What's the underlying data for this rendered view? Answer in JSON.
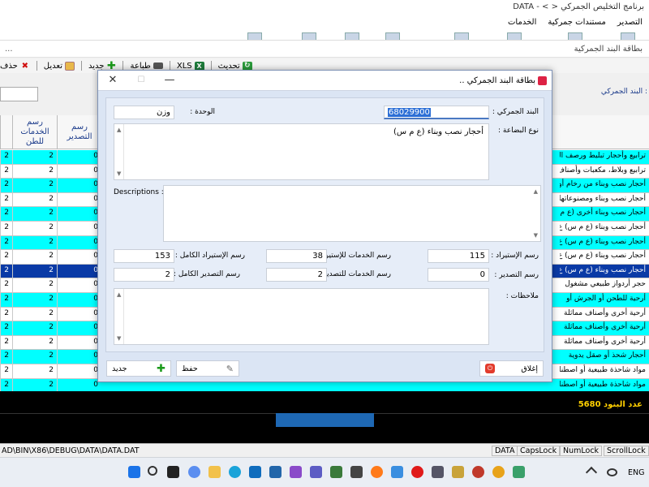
{
  "app": {
    "title": "DATA - < > برنامج التخليص الجمركي",
    "menu": [
      "التصدير",
      "مستندات جمركية",
      "الخدمات"
    ],
    "subtitle": "بطاقة البند الجمركية",
    "subtitle_dots": "..."
  },
  "toolbar": {
    "delete": "حذف",
    "edit": "تعديل",
    "new": "جديد",
    "print": "طباعة",
    "xls": "XLS",
    "refresh": "تحديث"
  },
  "search": {
    "label": "البند الجمركي :",
    "value": ""
  },
  "grid": {
    "headers": {
      "export_fee": "رسم\nالتصدير",
      "services_fee": "رسم\nالخدمات\nللطن",
      "col_a": ""
    },
    "rows": [
      {
        "desc": "ترابيع وأحجار تبليط ورصف الطرق",
        "export": "0",
        "services": "2",
        "a": "2",
        "style": "cyan"
      },
      {
        "desc": "ترابيع وبلاط، مكعبات وأصناف",
        "export": "0",
        "services": "2",
        "a": "2",
        "style": "white"
      },
      {
        "desc": "أحجار نصب وبناء من رخام أو",
        "export": "0",
        "services": "2",
        "a": "2",
        "style": "cyan"
      },
      {
        "desc": "أحجار نصب وبناء ومصنوعاتها",
        "export": "0",
        "services": "2",
        "a": "2",
        "style": "white"
      },
      {
        "desc": "أحجار نصب وبناء أخرى (ع م",
        "export": "0",
        "services": "2",
        "a": "2",
        "style": "cyan"
      },
      {
        "desc": "أحجار نصب وبناء (ع م س) ع",
        "export": "0",
        "services": "2",
        "a": "2",
        "style": "white"
      },
      {
        "desc": "أحجار نصب وبناء (ع م س) ع",
        "export": "0",
        "services": "2",
        "a": "2",
        "style": "cyan"
      },
      {
        "desc": "أحجار نصب وبناء (ع م س) ع",
        "export": "0",
        "services": "2",
        "a": "2",
        "style": "white"
      },
      {
        "desc": "أحجار نصب وبناء (ع م س) ع",
        "export": "0",
        "services": "2",
        "a": "2",
        "style": "sel"
      },
      {
        "desc": "حجر أردواز طبيعي مشغول",
        "export": "0",
        "services": "2",
        "a": "2",
        "style": "white"
      },
      {
        "desc": "أرحية للطحن أو الجرش أو",
        "export": "0",
        "services": "2",
        "a": "2",
        "style": "cyan"
      },
      {
        "desc": "أرحية أخرى وأصناف مماثلة",
        "export": "0",
        "services": "2",
        "a": "2",
        "style": "white"
      },
      {
        "desc": "أرحية أخرى وأصناف مماثلة",
        "export": "0",
        "services": "2",
        "a": "2",
        "style": "cyan"
      },
      {
        "desc": "أرحية أخرى وأصناف مماثلة",
        "export": "0",
        "services": "2",
        "a": "2",
        "style": "white"
      },
      {
        "desc": "أحجار شحذ أو صقل يدوية",
        "export": "0",
        "services": "2",
        "a": "2",
        "style": "cyan"
      },
      {
        "desc": "مواد شاحذة طبيعية أو اصطناعية",
        "export": "0",
        "services": "2",
        "a": "2",
        "style": "white"
      },
      {
        "desc": "مواد شاحذة طبيعية أو اصطناعية",
        "export": "0",
        "services": "2",
        "a": "2",
        "style": "cyan"
      }
    ]
  },
  "footer": {
    "count_label": "عدد البنود 5680"
  },
  "statusbar": {
    "path": "AD\\BIN\\X86\\DEBUG\\DATA\\DATA.DAT",
    "data": "DATA",
    "caps": "CapsLock",
    "num": "NumLock",
    "scroll": "ScrollLock"
  },
  "taskbar": {
    "lang": "ENG"
  },
  "dialog": {
    "title": "بطاقة البند الجمركي ..",
    "tariff_label": "البند الجمركي :",
    "tariff_value": "68029900",
    "unit_label": "الوحدة :",
    "unit_value": "وزن",
    "goods_type_label": "نوع البضاعة :",
    "goods_type_value": "أحجار نصب وبناء (ع م س)",
    "descriptions_label": "Descriptions :",
    "descriptions_value": "",
    "import_fee_label": "رسم الإستيراد :",
    "import_fee_value": "115",
    "import_services_label": "رسم الخدمات للإستيراد :",
    "import_services_value": "38",
    "full_import_label": "رسم الإستيراد الكامل :",
    "full_import_value": "153",
    "export_fee_label": "رسم التصدير :",
    "export_fee_value": "0",
    "export_services_label": "رسم الخدمات للتصدير :",
    "export_services_value": "2",
    "full_export_label": "رسم التصدير الكامل :",
    "full_export_value": "2",
    "notes_label": "ملاحظات :",
    "notes_value": "",
    "close_btn": "إغلاق",
    "save_btn": "حفظ",
    "new_btn": "جديد"
  }
}
